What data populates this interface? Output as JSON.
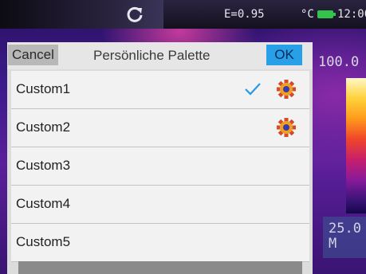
{
  "status_bar": {
    "emissivity": "E=0.95",
    "temp_unit": "°C",
    "clock": "12:00",
    "icons": [
      "refresh-icon",
      "battery-icon"
    ]
  },
  "scale": {
    "max": "100.0",
    "min_line1": "25.0",
    "min_line2": "M"
  },
  "dialog": {
    "cancel_label": "Cancel",
    "title": "Persönliche Palette",
    "ok_label": "OK",
    "items": [
      {
        "label": "Custom1",
        "checked": true,
        "has_settings": true
      },
      {
        "label": "Custom2",
        "checked": false,
        "has_settings": true
      },
      {
        "label": "Custom3",
        "checked": false,
        "has_settings": false
      },
      {
        "label": "Custom4",
        "checked": false,
        "has_settings": false
      },
      {
        "label": "Custom5",
        "checked": false,
        "has_settings": false
      }
    ]
  },
  "colors": {
    "ok_button": "#28a0e8",
    "check": "#2a9ae0",
    "battery": "#33c24a"
  }
}
